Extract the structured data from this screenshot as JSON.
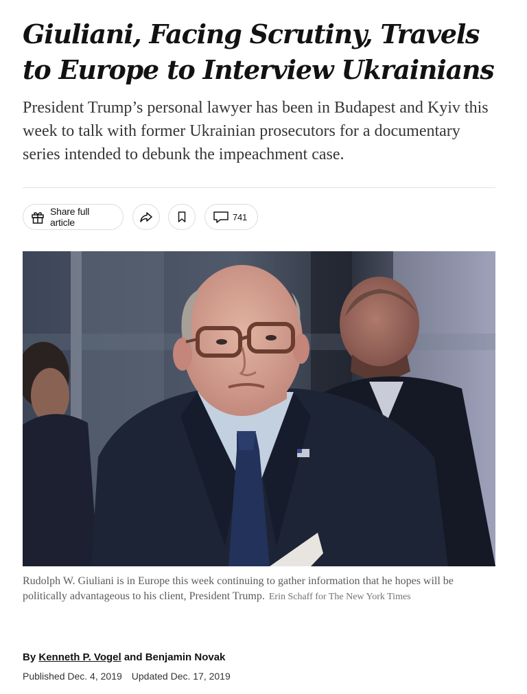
{
  "headline": "Giuliani, Facing Scrutiny, Travels to Europe to Interview Ukrainians",
  "summary": "President Trump’s personal lawyer has been in Budapest and Kyiv this week to talk with former Ukrainian prosecutors for a documentary series intended to debunk the impeachment case.",
  "share_bar": {
    "share_full_label": "Share full article",
    "share_icon": "share-arrow-icon",
    "save_icon": "bookmark-icon",
    "comment_icon": "speech-bubble-icon",
    "comment_count": "741"
  },
  "photo": {
    "caption": "Rudolph W. Giuliani is in Europe this week continuing to gather information that he hopes will be politically advantageous to his client, President Trump.",
    "credit": "Erin Schaff for The New York Times"
  },
  "byline": {
    "prefix": "By",
    "author1": "Kenneth P. Vogel",
    "joiner": "and",
    "author2": "Benjamin Novak"
  },
  "dates": {
    "published": "Published Dec. 4, 2019",
    "updated": "Updated Dec. 17, 2019"
  },
  "colors": {
    "text": "#121212",
    "summary": "#363636",
    "caption": "#5a5a5a",
    "border": "#dcdcdc"
  }
}
